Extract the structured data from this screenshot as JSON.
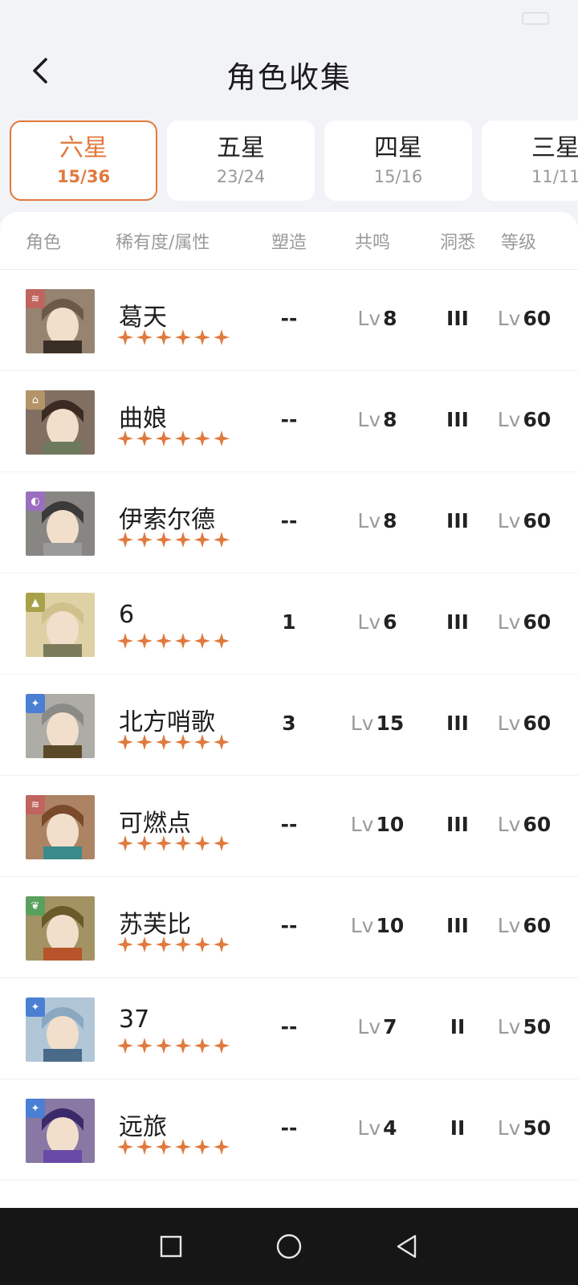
{
  "header": {
    "title": "角色收集"
  },
  "tabs": [
    {
      "name": "六星",
      "count": "15/36"
    },
    {
      "name": "五星",
      "count": "23/24"
    },
    {
      "name": "四星",
      "count": "15/16"
    },
    {
      "name": "三星",
      "count": "11/11"
    }
  ],
  "columns": {
    "role": "角色",
    "rarity": "稀有度/属性",
    "mold": "塑造",
    "resonance": "共鸣",
    "insight": "洞悉",
    "level": "等级"
  },
  "lv_prefix": "Lv",
  "stars_per_row": 6,
  "colors": {
    "accent": "#e07a3d",
    "star": "#e07a3d",
    "attr_beast": "#c0645f",
    "attr_plant": "#5aa05d",
    "attr_star": "#4a7fd4",
    "attr_mineral": "#a8a14a",
    "attr_spirit": "#9b6fc0",
    "attr_intellect": "#b39468"
  },
  "characters": [
    {
      "name": "葛天",
      "mold": "--",
      "resonance": "8",
      "insight": "III",
      "level": "60",
      "attribute": "beast-icon"
    },
    {
      "name": "曲娘",
      "mold": "--",
      "resonance": "8",
      "insight": "III",
      "level": "60",
      "attribute": "intellect-icon"
    },
    {
      "name": "伊索尔德",
      "mold": "--",
      "resonance": "8",
      "insight": "III",
      "level": "60",
      "attribute": "spirit-icon"
    },
    {
      "name": "6",
      "mold": "1",
      "resonance": "6",
      "insight": "III",
      "level": "60",
      "attribute": "mineral-icon"
    },
    {
      "name": "北方哨歌",
      "mold": "3",
      "resonance": "15",
      "insight": "III",
      "level": "60",
      "attribute": "star-icon"
    },
    {
      "name": "可燃点",
      "mold": "--",
      "resonance": "10",
      "insight": "III",
      "level": "60",
      "attribute": "beast-icon"
    },
    {
      "name": "苏芙比",
      "mold": "--",
      "resonance": "10",
      "insight": "III",
      "level": "60",
      "attribute": "plant-icon"
    },
    {
      "name": "37",
      "mold": "--",
      "resonance": "7",
      "insight": "II",
      "level": "50",
      "attribute": "star-icon"
    },
    {
      "name": "远旅",
      "mold": "--",
      "resonance": "4",
      "insight": "II",
      "level": "50",
      "attribute": "star-icon"
    }
  ]
}
